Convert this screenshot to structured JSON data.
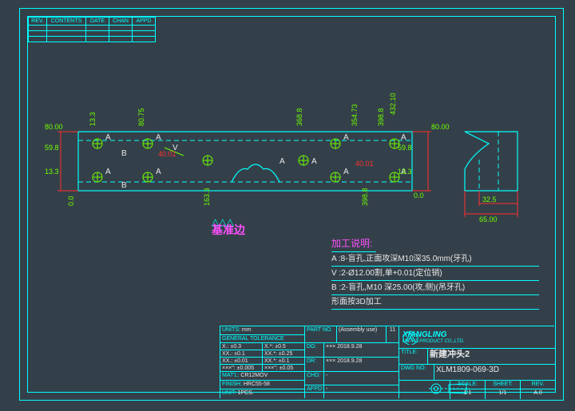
{
  "rev_header": {
    "c1": "REV.",
    "c2": "CONTENTS",
    "c3": "DATE",
    "c4": "CHAN",
    "c5": "APPD"
  },
  "datum_label": "基准边",
  "dims": {
    "h80_left": "80.00",
    "h80_right": "80.00",
    "v59_8_tl": "59.8",
    "v59_8_tr": "59.8",
    "v13_3_bl": "13.3",
    "v13_3_tl": "13.3",
    "v13_3_br": "13.3",
    "v40_01_l": "40.01",
    "v40_01_r": "40.01",
    "v80_75": "80.75",
    "v163_3": "163.3",
    "v368_8": "368.8",
    "v354_73": "354.73",
    "v398_8_a": "398.8",
    "v398_8_b": "398.8",
    "v432_10": "432.10",
    "v0_0_a": "0.0",
    "v0_0_b": "0.0",
    "side32_5": "32.5",
    "side65": "65.00"
  },
  "tags": {
    "A": "A",
    "B": "B",
    "V": "V"
  },
  "notes": {
    "title": "加工说明:",
    "a": "A :8-盲孔,正面攻深M10深35.0mm(牙孔)",
    "v": "V :2-Ø12.00割,单+0.01(定位销)",
    "b": "B :2-盲孔,M10 深25.00(攻,侧)(吊牙孔)",
    "f": "形面按3D加工"
  },
  "titleblock": {
    "units_lbl": "UNITS:",
    "units": "mm",
    "gentol": "GENERAL TOLERANCE",
    "tolrows": [
      [
        "X.: ±0.3",
        "X.*: ±0.5"
      ],
      [
        "XX.: ±0.1",
        "XX.*: ±0.25"
      ],
      [
        "XX.: ±0.01",
        "XX.*: ±0.1"
      ],
      [
        "×××\": ±0.005",
        "×××\": ±0.05"
      ]
    ],
    "matl_lbl": "MAT'L:",
    "matl": "CR12MOV",
    "finish_lbl": "FINISH:",
    "finish": "HRC55-58",
    "unit_lbl": "UNIT:",
    "unit": "1PCS.",
    "partno_lbl": "PART NO.",
    "partno": "(Assembly use)",
    "partcount": "11",
    "dg_lbl": "DG:",
    "dg": "××× 2018.9.28",
    "dr_lbl": "DR:",
    "dr": "××× 2018.9.28",
    "chd_lbl": "CHD:",
    "chd": "-",
    "appd_lbl": "APPD:",
    "appd": "-",
    "co_name": "XIANGLING",
    "co_sub": "METAL PRODUCT CO.,LTD.",
    "title_lbl": "TITLE:",
    "title": "新建冲头2",
    "dwgno_lbl": "DWG NO:",
    "dwgno": "XLM1809-069-3D",
    "scale_lbl": "SCALE:",
    "scale": "1:1",
    "sheet_lbl": "SHEET:",
    "sheet": "1/1",
    "rev_lbl": "REV.",
    "rev": "A.0"
  }
}
